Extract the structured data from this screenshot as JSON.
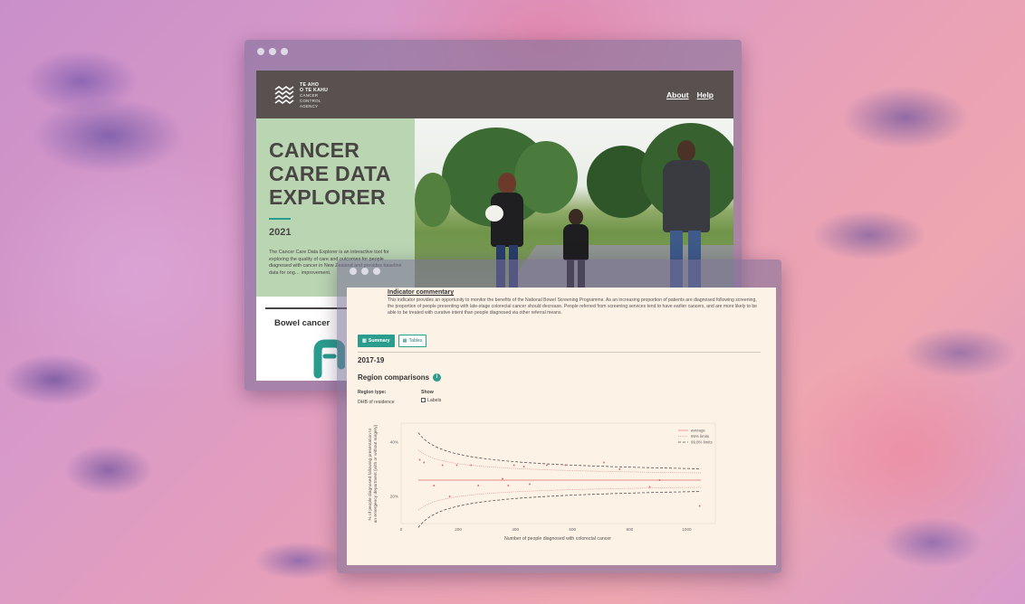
{
  "window1": {
    "logo": {
      "line1": "TE AHO",
      "line2": "O TE KAHU",
      "sub1": "CANCER",
      "sub2": "CONTROL",
      "sub3": "AGENCY"
    },
    "nav": [
      "About",
      "Help"
    ],
    "hero": {
      "title_lines": [
        "CANCER",
        "CARE DATA",
        "EXPLORER"
      ],
      "year": "2021",
      "description": "The Cancer Care Data Explorer is an interactive tool for exploring the quality of care and outcomes for people diagnosed with cancer in New Zealand and provides baseline data for ong… improvement."
    },
    "card": {
      "title": "Bowel cancer"
    }
  },
  "window2": {
    "commentary_title": "Indicator commentary",
    "commentary_body": "This indicator provides an opportunity to monitor the benefits of the National Bowel Screening Programme. As an increasing proportion of patients are diagnosed following screening, the proportion of people presenting with late-stage colorectal cancer should decrease. People referred from screening services tend to have earlier cancers, and are more likely to be able to be treated with curative intent than people diagnosed via other referral means.",
    "tabs": [
      {
        "label": "Summary",
        "icon": "chart-icon",
        "active": true
      },
      {
        "label": "Tables",
        "icon": "table-icon",
        "active": false
      }
    ],
    "period": "2017-19",
    "region_title": "Region comparisons",
    "region_type_label": "Region type:",
    "region_type_value": "DHB of residence",
    "show_label": "Show",
    "show_option": "Labels"
  },
  "chart_data": {
    "type": "scatter",
    "title": "",
    "xlabel": "Number of people diagnosed with colorectal cancer",
    "ylabel": "% of people diagnosed following presentation to an emergency department (with or without surgery)",
    "xlim": [
      0,
      1100
    ],
    "ylim": [
      10,
      47
    ],
    "xticks": [
      0,
      200,
      400,
      600,
      800,
      1000
    ],
    "yticks": [
      20,
      40
    ],
    "ytick_labels": [
      "20%",
      "40%"
    ],
    "average": 26,
    "legend": [
      "average",
      "95% limits",
      "99.8% limits"
    ],
    "legend_position": "top-right",
    "colors": {
      "average": "#e88a8a",
      "limit95": "#e88a8a",
      "limit998": "#555555",
      "points": "#e06a78"
    },
    "points": [
      {
        "x": 65,
        "y": 33.5
      },
      {
        "x": 80,
        "y": 32.5
      },
      {
        "x": 115,
        "y": 24
      },
      {
        "x": 145,
        "y": 31.5
      },
      {
        "x": 170,
        "y": 20
      },
      {
        "x": 195,
        "y": 31.5
      },
      {
        "x": 245,
        "y": 31.5
      },
      {
        "x": 270,
        "y": 24
      },
      {
        "x": 355,
        "y": 26.5
      },
      {
        "x": 375,
        "y": 24
      },
      {
        "x": 395,
        "y": 31.5
      },
      {
        "x": 430,
        "y": 31
      },
      {
        "x": 450,
        "y": 24.5
      },
      {
        "x": 510,
        "y": 31.5
      },
      {
        "x": 575,
        "y": 31.5
      },
      {
        "x": 710,
        "y": 32.5
      },
      {
        "x": 765,
        "y": 30
      },
      {
        "x": 870,
        "y": 23.5
      },
      {
        "x": 905,
        "y": 26
      },
      {
        "x": 1045,
        "y": 16.5
      }
    ]
  }
}
